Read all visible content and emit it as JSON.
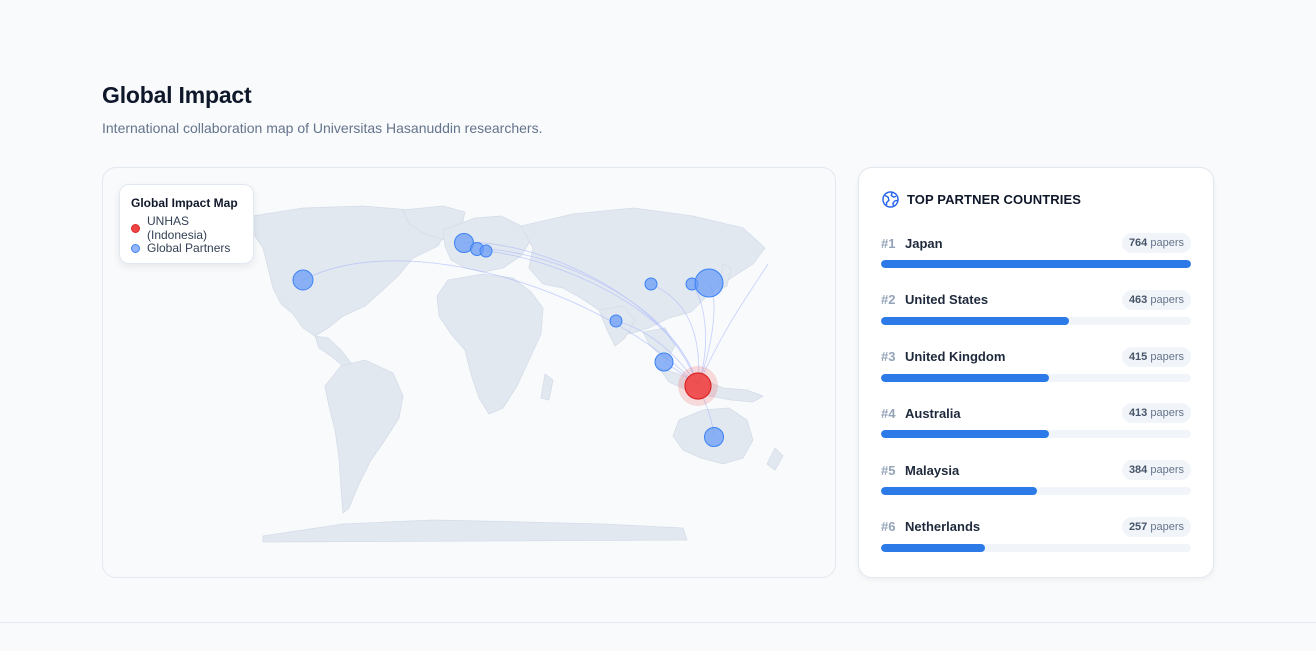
{
  "page": {
    "title": "Global Impact",
    "subtitle": "International collaboration map of Universitas Hasanuddin researchers."
  },
  "map": {
    "legend": {
      "title": "Global Impact Map",
      "home_label": "UNHAS (Indonesia)",
      "partner_label": "Global Partners"
    },
    "colors": {
      "land": "#e2e8f0",
      "home": "#ef4444",
      "partner": "#6b9cf5",
      "arc": "#a5b4fc"
    }
  },
  "ranking": {
    "title": "TOP PARTNER COUNTRIES",
    "icon": "globe-icon",
    "unit": "papers",
    "items": [
      {
        "rank": "#1",
        "country": "Japan",
        "count": "764",
        "value": 764
      },
      {
        "rank": "#2",
        "country": "United States",
        "count": "463",
        "value": 463
      },
      {
        "rank": "#3",
        "country": "United Kingdom",
        "count": "415",
        "value": 415
      },
      {
        "rank": "#4",
        "country": "Australia",
        "count": "413",
        "value": 413
      },
      {
        "rank": "#5",
        "country": "Malaysia",
        "count": "384",
        "value": 384
      },
      {
        "rank": "#6",
        "country": "Netherlands",
        "count": "257",
        "value": 257
      }
    ],
    "max_value": 764,
    "bar_color": "#2b7ae8"
  }
}
